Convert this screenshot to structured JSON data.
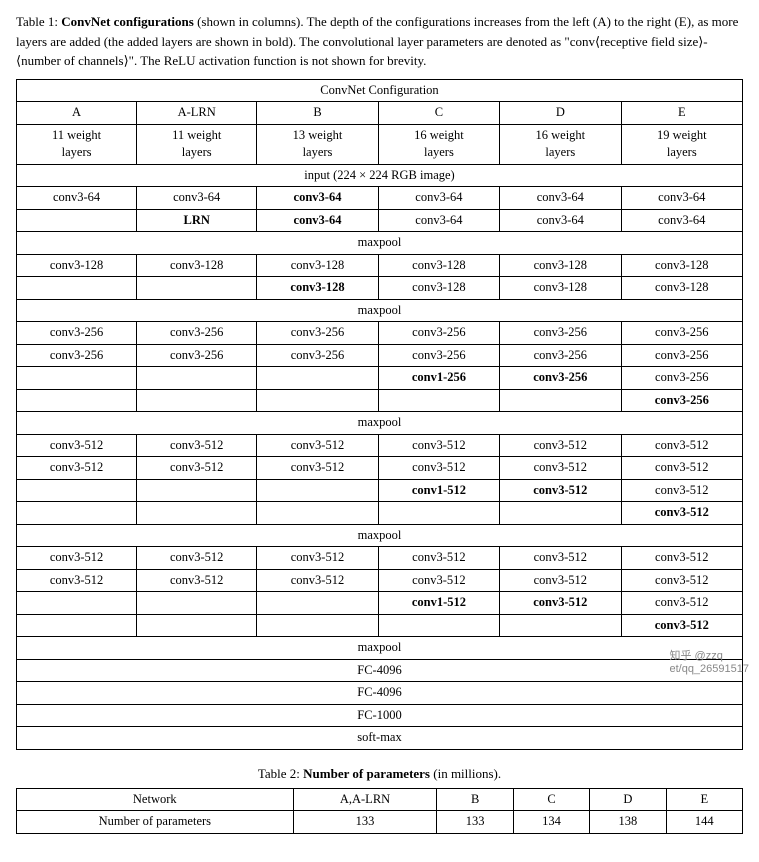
{
  "table1": {
    "caption_pre": "Table 1: ",
    "caption_bold": "ConvNet configurations",
    "caption_rest": " (shown in columns). The depth of the configurations increases from the left (A) to the right (E), as more layers are added (the added layers are shown in bold). The convolutional layer parameters are denoted as \"conv⟨receptive field size⟩-⟨number of channels⟩\". The ReLU activation function is not shown for brevity.",
    "config_header": "ConvNet Configuration",
    "columns": [
      "A",
      "A-LRN",
      "B",
      "C",
      "D",
      "E"
    ],
    "weight_layers": [
      "11 weight layers",
      "11 weight layers",
      "13 weight layers",
      "16 weight layers",
      "16 weight layers",
      "19 weight layers"
    ],
    "input_row": "input (224 × 224 RGB image)",
    "maxpool": "maxpool",
    "fc4096a": "FC-4096",
    "fc4096b": "FC-4096",
    "fc1000": "FC-1000",
    "softmax": "soft-max"
  },
  "table2": {
    "caption_pre": "Table 2: ",
    "caption_bold": "Number of parameters",
    "caption_rest": " (in millions).",
    "headers": [
      "Network",
      "A,A-LRN",
      "B",
      "C",
      "D",
      "E"
    ],
    "row_label": "Number of parameters",
    "values": [
      "133",
      "133",
      "134",
      "138",
      "144"
    ]
  },
  "watermark": "知乎 @zzq\net/qq_26591517"
}
